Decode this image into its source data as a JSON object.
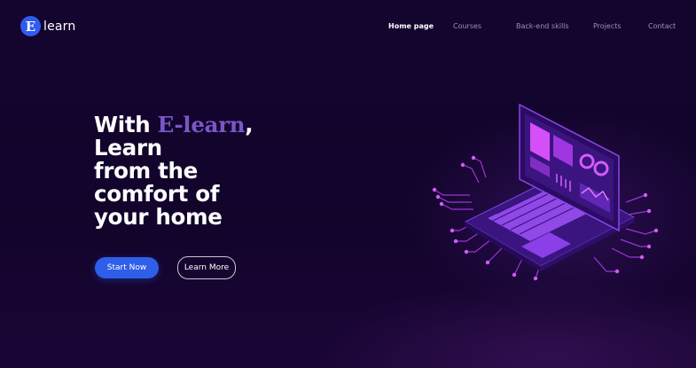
{
  "logo": {
    "badge_letter": "E",
    "text": "learn"
  },
  "nav": {
    "items": [
      {
        "label": "Home page",
        "active": true
      },
      {
        "label": "Courses",
        "active": false
      },
      {
        "label": "Back-end skills",
        "active": false
      },
      {
        "label": "Projects",
        "active": false
      },
      {
        "label": "Contact",
        "active": false
      }
    ]
  },
  "hero": {
    "title_prefix": "With ",
    "title_brand": "E-learn",
    "title_line2_rest": ", Learn",
    "title_line3": "from the",
    "title_line4": "comfort of",
    "title_line5": "your home",
    "primary_button": "Start Now",
    "secondary_button": "Learn More"
  },
  "colors": {
    "background": "#12052e",
    "accent_blue": "#2f5ee8",
    "brand_purple": "#7a57c8",
    "illustration_purple": "#b13cf0"
  },
  "illustration": {
    "icon": "laptop-circuit-icon"
  }
}
